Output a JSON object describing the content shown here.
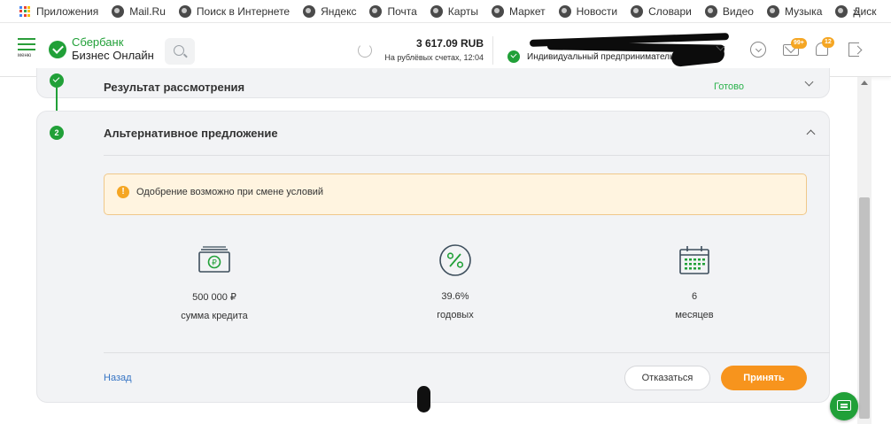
{
  "bookmarks": {
    "apps_label": "Приложения",
    "items": [
      "Mail.Ru",
      "Поиск в Интернете",
      "Яндекс",
      "Почта",
      "Карты",
      "Маркет",
      "Новости",
      "Словари",
      "Видео",
      "Музыка",
      "Диск"
    ],
    "more": "»"
  },
  "header": {
    "menu_label": "меню",
    "logo_line1": "Сбербанк",
    "logo_line2": "Бизнес Онлайн",
    "balance_amount": "3 617.09 RUB",
    "balance_sub": "На рублёвых счетах, 12:04",
    "org_type": "Индивидуальный предприниматель",
    "mail_badge": "99+",
    "notif_badge": "12"
  },
  "steps": {
    "step1": {
      "title": "Результат рассмотрения",
      "status": "Готово"
    },
    "step2": {
      "number": "2",
      "title": "Альтернативное предложение"
    }
  },
  "alert": {
    "text": "Одобрение возможно при смене условий"
  },
  "metrics": [
    {
      "icon": "money-icon",
      "value": "500 000 ₽",
      "label": "сумма кредита"
    },
    {
      "icon": "percent-icon",
      "value": "39.6%",
      "label": "годовых"
    },
    {
      "icon": "calendar-icon",
      "value": "6",
      "label": "месяцев"
    }
  ],
  "actions": {
    "back": "Назад",
    "decline": "Отказаться",
    "accept": "Принять"
  },
  "colors": {
    "brand_green": "#21a038",
    "accent_orange": "#f7941d",
    "warning_bg": "#fff4e0",
    "link_blue": "#3574c4"
  }
}
